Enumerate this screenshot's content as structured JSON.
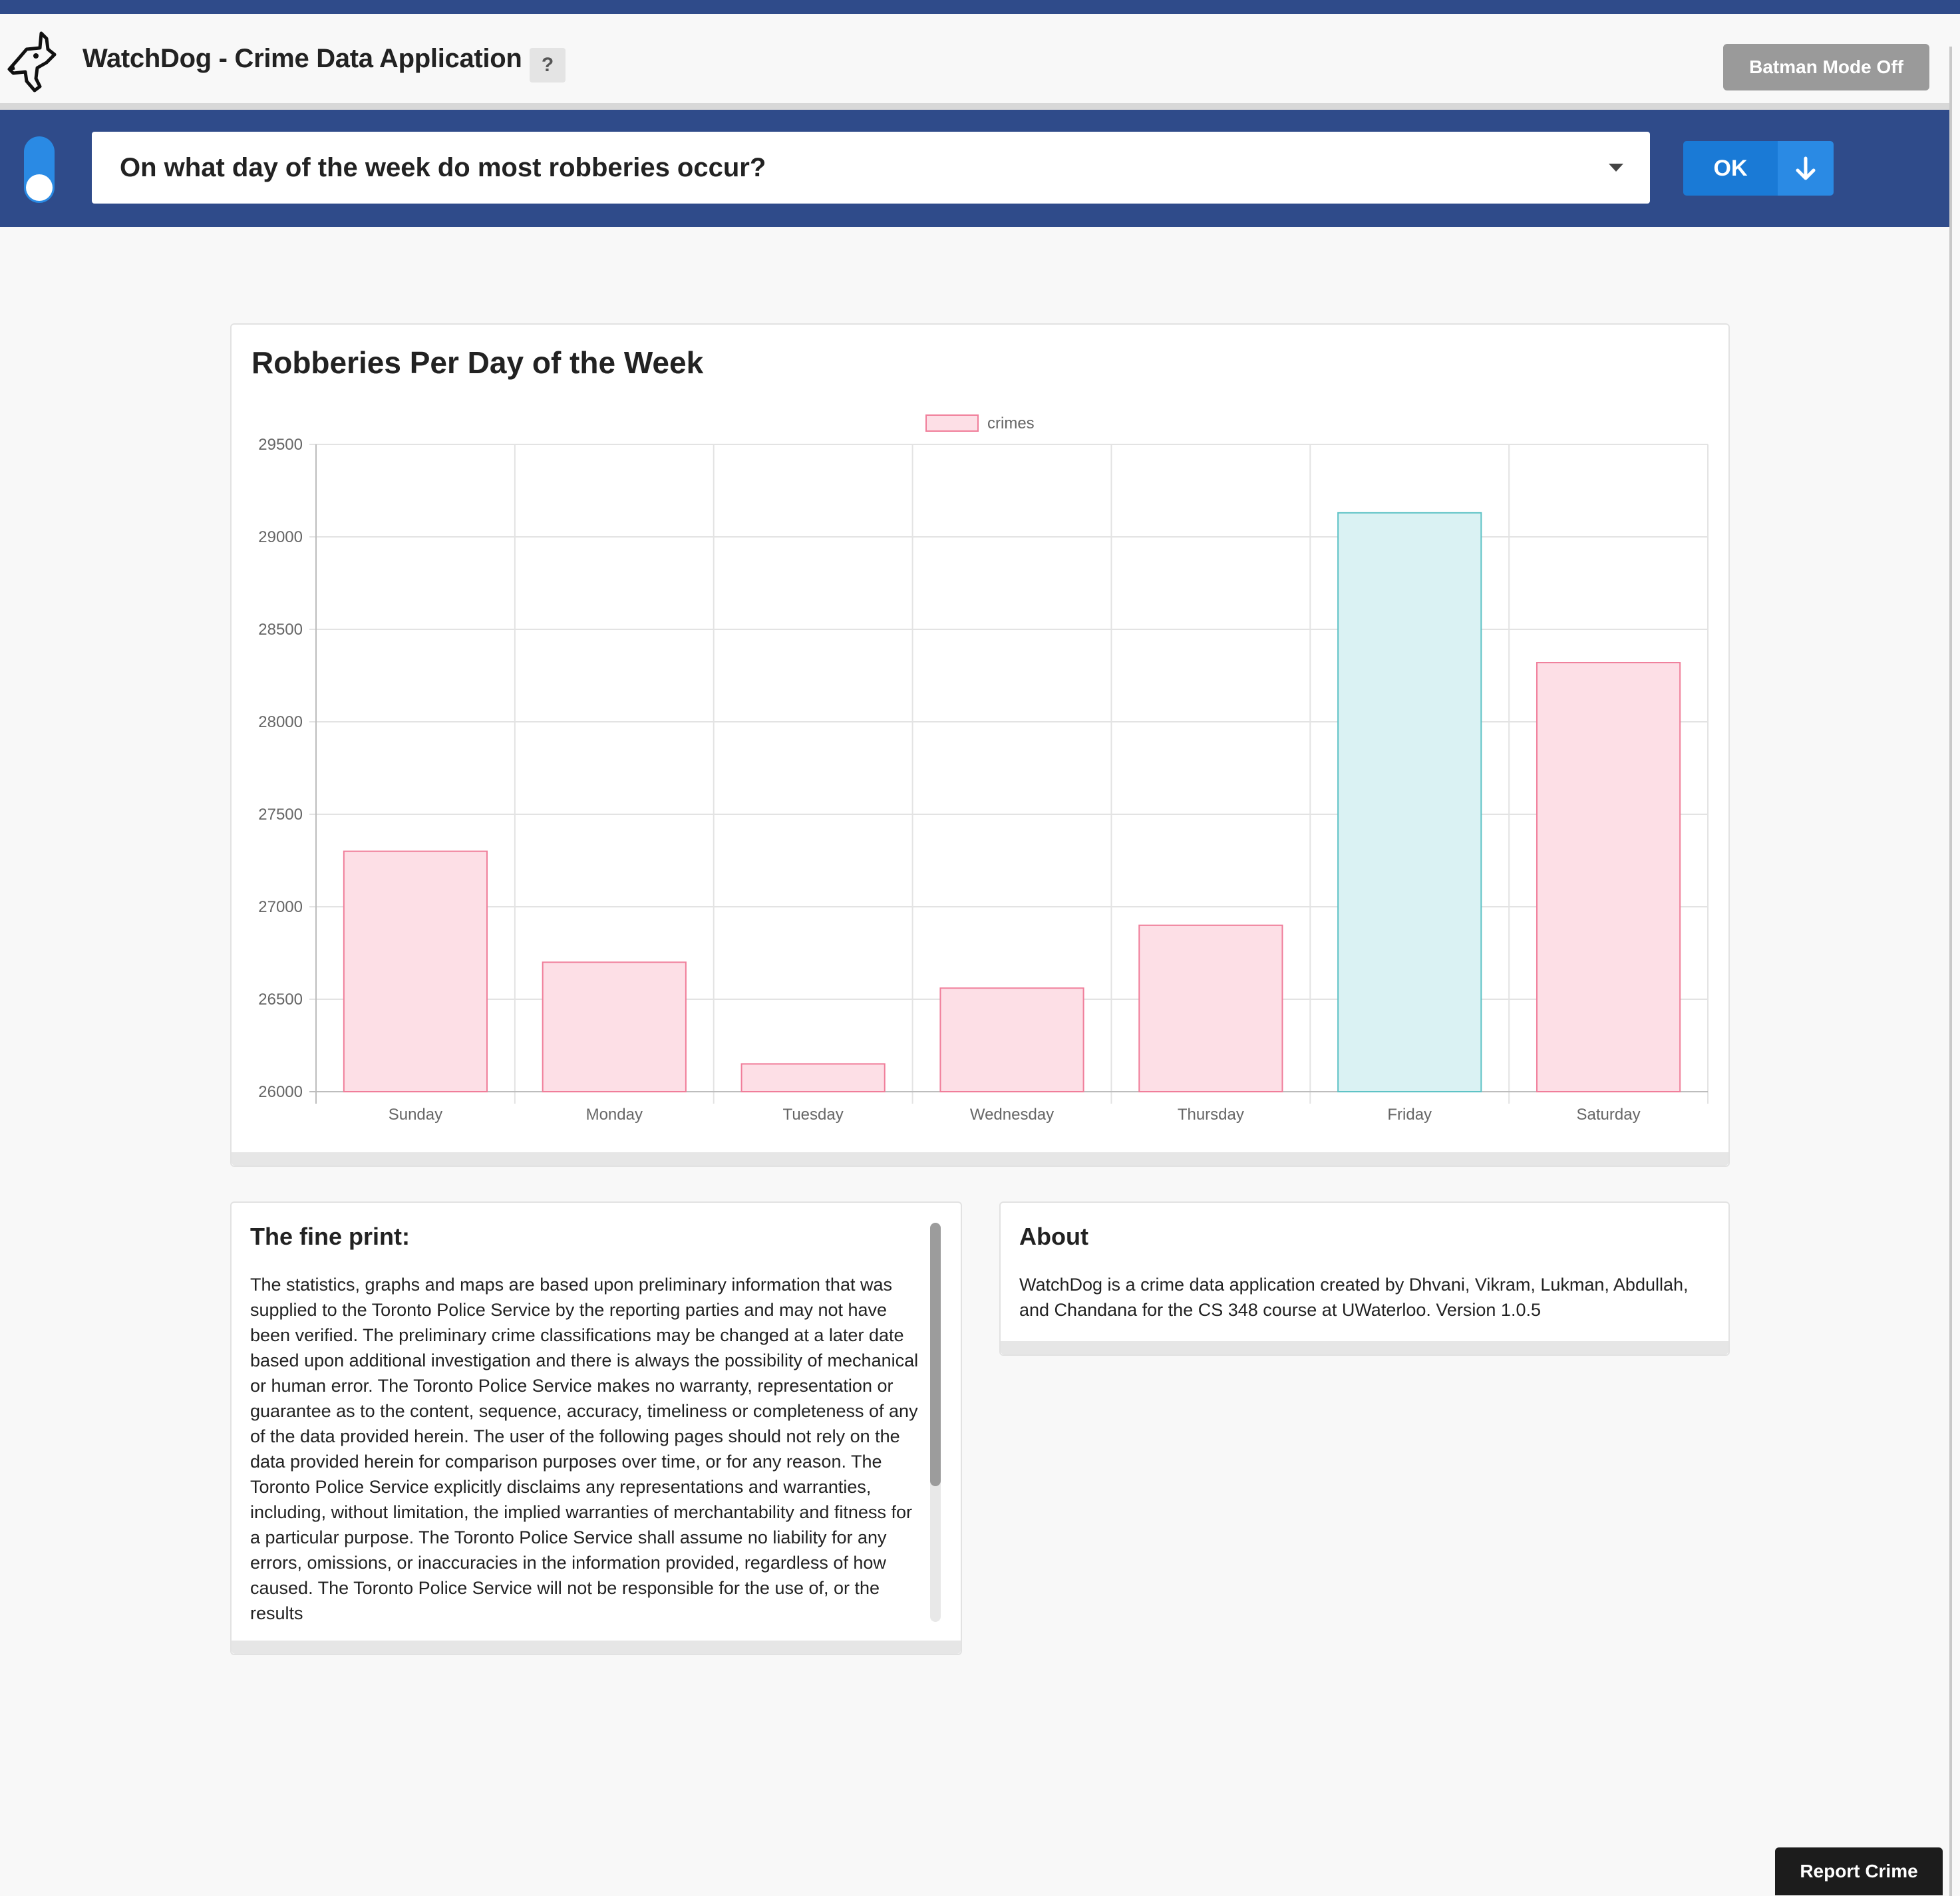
{
  "app": {
    "title": "WatchDog - Crime Data Application",
    "help_label": "?",
    "batman_label": "Batman Mode Off",
    "logo_icon": "dog-head-logo"
  },
  "query": {
    "question": "On what day of the week do most robberies occur?",
    "ok_label": "OK",
    "down_icon": "arrow-down-icon"
  },
  "colors": {
    "header_blue": "#2f4b8a",
    "button_blue": "#1a7ad6",
    "bar_pink_fill": "#fddfe6",
    "bar_pink_stroke": "#f07e9a",
    "bar_teal_fill": "#daf2f3",
    "bar_teal_stroke": "#5fc3c6"
  },
  "chart_data": {
    "type": "bar",
    "title": "Robberies Per Day of the Week",
    "categories": [
      "Sunday",
      "Monday",
      "Tuesday",
      "Wednesday",
      "Thursday",
      "Friday",
      "Saturday"
    ],
    "series": [
      {
        "name": "crimes",
        "values": [
          27300,
          26700,
          26150,
          26560,
          26900,
          29130,
          28320
        ]
      }
    ],
    "highlight_index": 5,
    "ylim": [
      26000,
      29500
    ],
    "yticks": [
      29500,
      29000,
      28500,
      28000,
      27500,
      27000,
      26500,
      26000
    ],
    "grid": true,
    "legend": "top"
  },
  "fine_print": {
    "heading": "The fine print:",
    "body": "The statistics, graphs and maps are based upon preliminary information that was supplied to the Toronto Police Service by the reporting parties and may not have been verified. The preliminary crime classifications may be changed at a later date based upon additional investigation and there is always the possibility of mechanical or human error. The Toronto Police Service makes no warranty, representation or guarantee as to the content, sequence, accuracy, timeliness or completeness of any of the data provided herein. The user of the following pages should not rely on the data provided herein for comparison purposes over time, or for any reason. The Toronto Police Service explicitly disclaims any representations and warranties, including, without limitation, the implied warranties of merchantability and fitness for a particular purpose. The Toronto Police Service shall assume no liability for any errors, omissions, or inaccuracies in the information provided, regardless of how caused. The Toronto Police Service will not be responsible for the use of, or the results"
  },
  "about": {
    "heading": "About",
    "body": "WatchDog is a crime data application created by Dhvani, Vikram, Lukman, Abdullah, and Chandana for the CS 348 course at UWaterloo. Version 1.0.5"
  },
  "footer": {
    "report_label": "Report Crime"
  }
}
